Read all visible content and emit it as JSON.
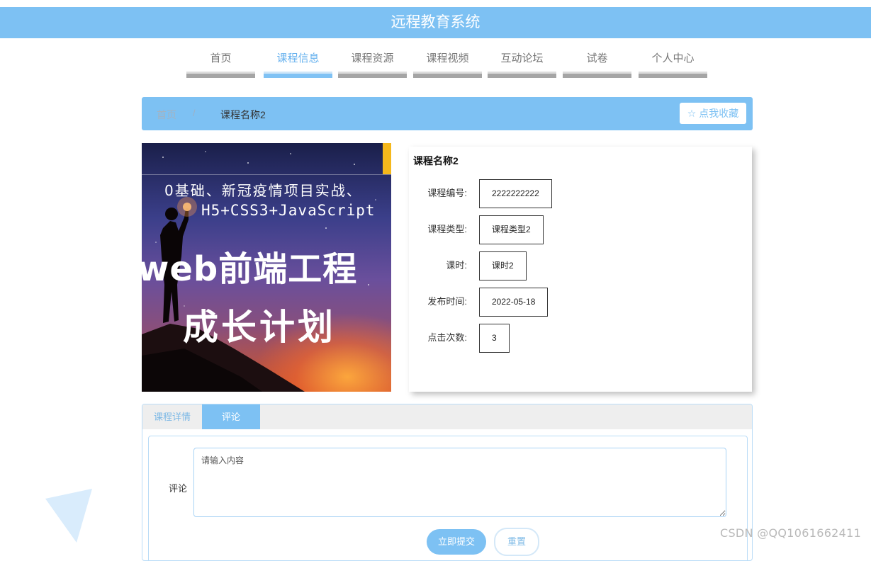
{
  "header": {
    "title": "远程教育系统"
  },
  "nav": {
    "items": [
      {
        "label": "首页",
        "active": false
      },
      {
        "label": "课程信息",
        "active": true
      },
      {
        "label": "课程资源",
        "active": false
      },
      {
        "label": "课程视频",
        "active": false
      },
      {
        "label": "互动论坛",
        "active": false
      },
      {
        "label": "试卷",
        "active": false
      },
      {
        "label": "个人中心",
        "active": false
      }
    ]
  },
  "breadcrumb": {
    "home": "首页",
    "separator": "/",
    "current": "课程名称2"
  },
  "favorite": {
    "icon": "star-outline-icon",
    "label": "☆ 点我收藏"
  },
  "cover": {
    "line1": "0基础、新冠疫情项目实战、",
    "line2": "H5+CSS3+JavaScript",
    "line3": "web前端工程",
    "line4": "成长计划"
  },
  "course": {
    "title": "课程名称2",
    "fields": [
      {
        "label": "课程编号:",
        "value": "2222222222"
      },
      {
        "label": "课程类型:",
        "value": "课程类型2"
      },
      {
        "label": "课时:",
        "value": "课时2"
      },
      {
        "label": "发布时间:",
        "value": "2022-05-18"
      },
      {
        "label": "点击次数:",
        "value": "3"
      }
    ]
  },
  "tabs": {
    "detail": "课程详情",
    "comment": "评论",
    "active": "comment"
  },
  "comment_form": {
    "label": "评论",
    "placeholder": "请输入内容",
    "submit_label": "立即提交",
    "reset_label": "重置"
  },
  "watermark": "CSDN @QQ1061662411",
  "colors": {
    "primary": "#7dc1f3",
    "nav_active": "#66b1ee"
  }
}
